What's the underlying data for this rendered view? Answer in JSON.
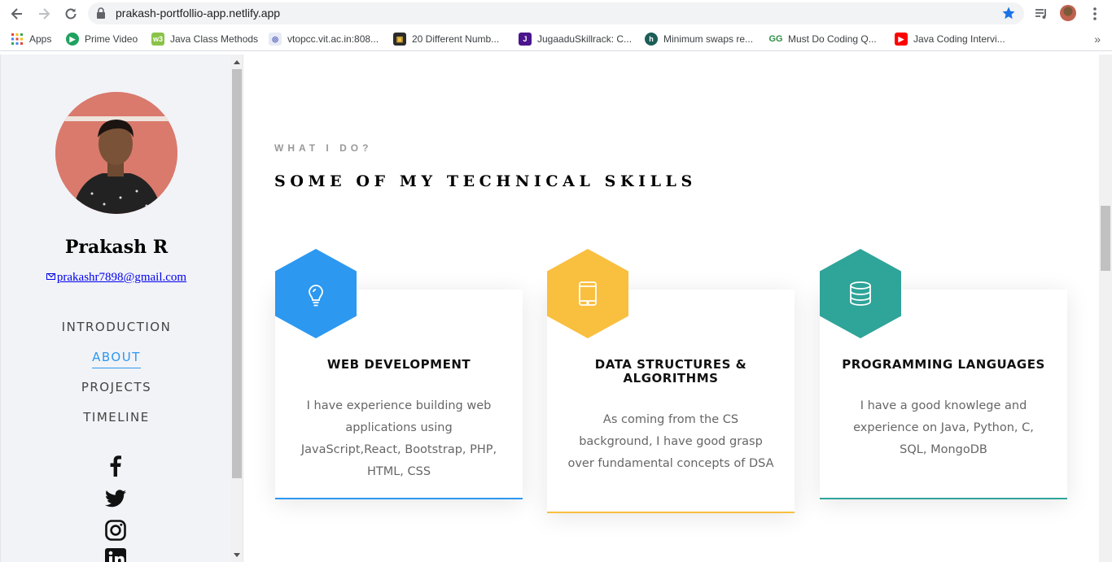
{
  "browser": {
    "url": "prakash-portfollio-app.netlify.app",
    "bookmarks": [
      {
        "label": "Apps",
        "icon": "apps-grid-icon"
      },
      {
        "label": "Prime Video",
        "icon": "prime-video-icon"
      },
      {
        "label": "Java Class Methods",
        "icon": "w3schools-icon"
      },
      {
        "label": "vtopcc.vit.ac.in:808...",
        "icon": "vit-icon"
      },
      {
        "label": "20 Different Numb...",
        "icon": "skillrack-icon"
      },
      {
        "label": "JugaaduSkillrack: C...",
        "icon": "jugaadu-icon"
      },
      {
        "label": "Minimum swaps re...",
        "icon": "hackerrank-icon"
      },
      {
        "label": "Must Do Coding Q...",
        "icon": "geeksforgeeks-icon"
      },
      {
        "label": "Java Coding Intervi...",
        "icon": "youtube-icon"
      }
    ],
    "more": "»"
  },
  "profile": {
    "name": "Prakash R",
    "email": "prakashr7898@gmail.com"
  },
  "nav": [
    {
      "label": "INTRODUCTION",
      "active": false
    },
    {
      "label": "ABOUT",
      "active": true
    },
    {
      "label": "PROJECTS",
      "active": false
    },
    {
      "label": "TIMELINE",
      "active": false
    }
  ],
  "social": [
    "facebook-icon",
    "twitter-icon",
    "instagram-icon",
    "linkedin-icon"
  ],
  "section": {
    "eyebrow": "WHAT I DO?",
    "heading": "SOME OF MY TECHNICAL SKILLS"
  },
  "cards": [
    {
      "title": "WEB DEVELOPMENT",
      "description": "I have experience building web applications using JavaScript,React, Bootstrap, PHP, HTML, CSS",
      "color": "#2c98f0",
      "icon": "lightbulb-icon"
    },
    {
      "title": "DATA STRUCTURES & ALGORITHMS",
      "description": "As coming from the CS background, I have good grasp over fundamental concepts of DSA",
      "color": "#f9bf3f",
      "icon": "tablet-icon"
    },
    {
      "title": "PROGRAMMING LANGUAGES",
      "description": "I have a good knowlege and experience on Java, Python, C, SQL, MongoDB",
      "color": "#2fa499",
      "icon": "database-icon"
    }
  ]
}
